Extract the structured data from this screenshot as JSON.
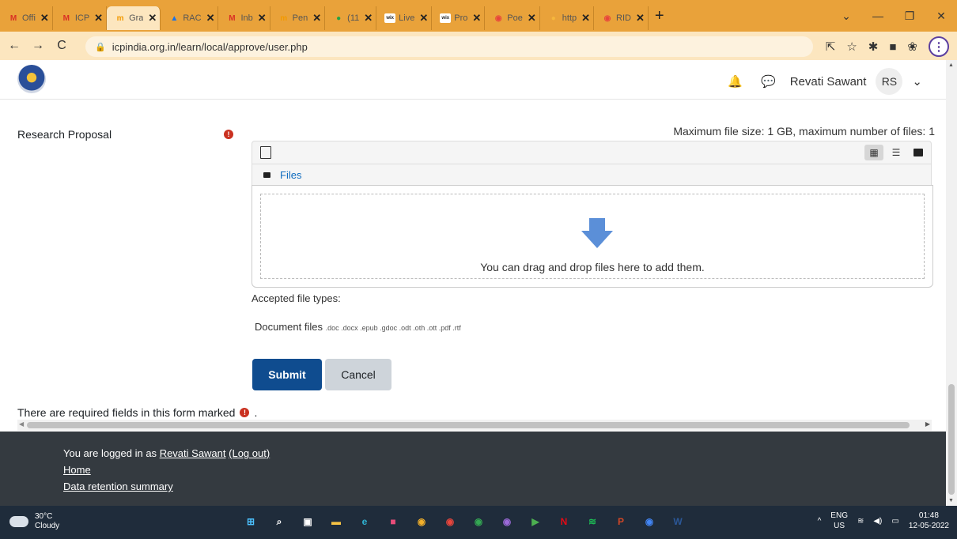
{
  "browser": {
    "tabs": [
      {
        "label": "Offi",
        "fav": "M",
        "color": "#d93025",
        "bg": "transparent",
        "active": false
      },
      {
        "label": "ICP",
        "fav": "M",
        "color": "#d93025",
        "bg": "transparent",
        "active": false
      },
      {
        "label": "Gra",
        "fav": "m",
        "color": "#f29900",
        "bg": "transparent",
        "active": true
      },
      {
        "label": "RAC",
        "fav": "▲",
        "color": "#1a73e8",
        "bg": "transparent",
        "active": false
      },
      {
        "label": "Inb",
        "fav": "M",
        "color": "#d93025",
        "bg": "transparent",
        "active": false
      },
      {
        "label": "Pen",
        "fav": "m",
        "color": "#f29900",
        "bg": "transparent",
        "active": false
      },
      {
        "label": "(11",
        "fav": "●",
        "color": "#25a244",
        "bg": "transparent",
        "active": false
      },
      {
        "label": "Live",
        "fav": "wix",
        "color": "#222222",
        "bg": "#ffffff",
        "active": false
      },
      {
        "label": "Pro",
        "fav": "wix",
        "color": "#222222",
        "bg": "#ffffff",
        "active": false
      },
      {
        "label": "Poe",
        "fav": "◉",
        "color": "#e8453c",
        "bg": "transparent",
        "active": false
      },
      {
        "label": "http",
        "fav": "●",
        "color": "#f6b73c",
        "bg": "transparent",
        "active": false
      },
      {
        "label": "RID",
        "fav": "◉",
        "color": "#e8453c",
        "bg": "transparent",
        "active": false
      }
    ],
    "tab_close": "✕",
    "new_tab": "+",
    "window_controls": {
      "dropdown": "⌄",
      "minimize": "—",
      "restore": "❐",
      "close": "✕"
    },
    "url": "icpindia.org.in/learn/local/approve/user.php",
    "nav": {
      "back": "←",
      "forward": "→",
      "reload": "C"
    },
    "toolbar_icons": {
      "share": "⇱",
      "star": "☆",
      "extensions": "✱",
      "sidebar": "■",
      "profile": "❀",
      "menu": "⋮"
    }
  },
  "site_header": {
    "notifications_icon": "🔔",
    "messages_icon": "💬",
    "user_name": "Revati Sawant",
    "user_initials": "RS",
    "menu_chevron": "⌄"
  },
  "form": {
    "field_label": "Research Proposal",
    "required_mark": "!",
    "max_size": "Maximum file size: 1 GB, maximum number of files: 1",
    "path_label": "Files",
    "drop_text": "You can drag and drop files here to add them.",
    "accepted_label": "Accepted file types:",
    "doc_type_label": "Document files",
    "doc_extensions": ".doc .docx .epub .gdoc .odt .oth .ott .pdf .rtf",
    "view_icons": {
      "grid": "▦",
      "list": "☰",
      "tree": "▬"
    },
    "submit_label": "Submit",
    "cancel_label": "Cancel",
    "required_note": "There are required fields in this form marked",
    "required_note_suffix": "."
  },
  "footer": {
    "logged_in_prefix": "You are logged in as",
    "logged_in_user": "Revati Sawant",
    "logout": "(Log out)",
    "home": "Home",
    "data_retention": "Data retention summary"
  },
  "taskbar": {
    "weather_temp": "30°C",
    "weather_desc": "Cloudy",
    "apps": [
      {
        "name": "start",
        "glyph": "⊞",
        "color": "#4cc2ff"
      },
      {
        "name": "search",
        "glyph": "⌕",
        "color": "#ffffff"
      },
      {
        "name": "task-view",
        "glyph": "▣",
        "color": "#ffffff"
      },
      {
        "name": "file-explorer",
        "glyph": "▬",
        "color": "#f6c344"
      },
      {
        "name": "edge",
        "glyph": "e",
        "color": "#2fb3d3"
      },
      {
        "name": "store",
        "glyph": "■",
        "color": "#e94d7a"
      },
      {
        "name": "chrome-1",
        "glyph": "◉",
        "color": "#f2b02a"
      },
      {
        "name": "chrome-2",
        "glyph": "◉",
        "color": "#e8453c"
      },
      {
        "name": "chrome-3",
        "glyph": "◉",
        "color": "#34a853"
      },
      {
        "name": "chrome-4",
        "glyph": "◉",
        "color": "#9c6ad9"
      },
      {
        "name": "teams",
        "glyph": "▶",
        "color": "#4caf50"
      },
      {
        "name": "netflix",
        "glyph": "N",
        "color": "#e50914"
      },
      {
        "name": "spotify",
        "glyph": "≋",
        "color": "#1db954"
      },
      {
        "name": "powerpoint",
        "glyph": "P",
        "color": "#d24726"
      },
      {
        "name": "chrome-5",
        "glyph": "◉",
        "color": "#4285f4"
      },
      {
        "name": "word",
        "glyph": "W",
        "color": "#2b5797"
      }
    ],
    "tray_chevron": "^",
    "lang": "ENG",
    "region": "US",
    "wifi": "≋",
    "volume": "◀)",
    "battery": "▭",
    "time": "01:48",
    "date": "12-05-2022"
  }
}
